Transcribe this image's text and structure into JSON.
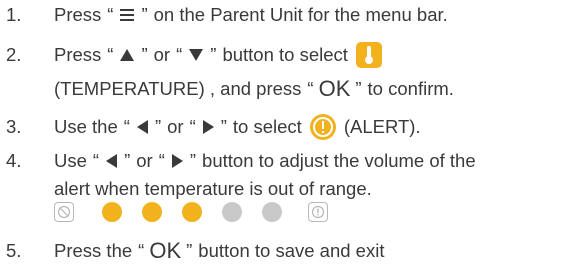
{
  "colors": {
    "text": "#3a3a3a",
    "accent": "#f2b21e",
    "inactive": "#c9c9c9"
  },
  "steps": [
    {
      "number": "1.",
      "lines": [
        {
          "p1": "Press",
          "q_open": "“",
          "icon": "menu-icon",
          "q_close": "”",
          "p2": "on the Parent Unit for the menu bar."
        }
      ]
    },
    {
      "number": "2.",
      "lines": [
        {
          "p1": "Press",
          "q1_open": "“",
          "icon1": "up-triangle-icon",
          "q1_close": "”",
          "or": "or",
          "q2_open": "“",
          "icon2": "down-triangle-icon",
          "q2_close": "”",
          "p2": "button to select",
          "badge": "thermometer-icon"
        },
        {
          "p1": "(TEMPERATURE) , and press",
          "q_open": "“",
          "ok": "OK",
          "q_close": "”",
          "p2": "to confirm."
        }
      ]
    },
    {
      "number": "3.",
      "lines": [
        {
          "p1": "Use the",
          "q1_open": "“",
          "icon1": "left-triangle-icon",
          "q1_close": "”",
          "or": "or",
          "q2_open": "“",
          "icon2": "right-triangle-icon",
          "q2_close": "”",
          "p2": "to select",
          "badge": "alert-icon",
          "p3": "(ALERT)."
        }
      ]
    },
    {
      "number": "4.",
      "lines": [
        {
          "p1": "Use",
          "q1_open": "“",
          "icon1": "left-triangle-icon",
          "q1_close": "”",
          "or": "or",
          "q2_open": "“",
          "icon2": "right-triangle-icon",
          "q2_close": "”",
          "p2": "button to adjust the volume of the"
        },
        {
          "p1": "alert when temperature is out of range."
        }
      ],
      "volume_scale": {
        "min_icon": "mute-icon",
        "max_icon": "alert-max-icon",
        "level": 3,
        "steps": 5
      }
    },
    {
      "number": "5.",
      "lines": [
        {
          "p1": "Press the",
          "q_open": "“",
          "ok": "OK",
          "q_close": "”",
          "p2": "button to save and exit"
        }
      ]
    }
  ]
}
